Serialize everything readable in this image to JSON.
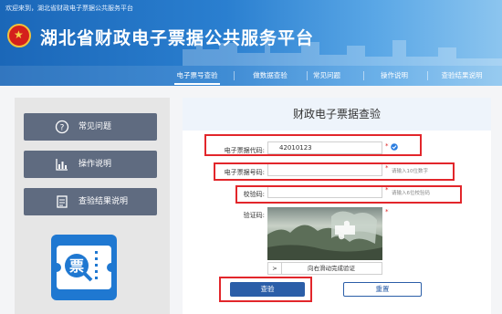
{
  "header": {
    "welcome": "欢迎来到，湖北省财政电子票据公共服务平台",
    "title": "湖北省财政电子票据公共服务平台",
    "nav": [
      "电子票号查验",
      "做数据查验",
      "常见问题",
      "操作说明",
      "查验结果说明"
    ]
  },
  "sidebar": {
    "items": [
      {
        "label": "常见问题",
        "icon": "question-icon"
      },
      {
        "label": "操作说明",
        "icon": "chart-icon"
      },
      {
        "label": "查验结果说明",
        "icon": "document-icon"
      }
    ],
    "logo_text": "票"
  },
  "main": {
    "title": "财政电子票据查验",
    "fields": {
      "code_label": "电子票据代码:",
      "code_value": "42010123",
      "number_label": "电子票据号码:",
      "number_placeholder": "请输入10位数字",
      "check_label": "校验码:",
      "check_placeholder": "请输入6位校验码",
      "captcha_label": "验证码:",
      "required_mark": "*"
    },
    "slider_text": "向右滑动完成验证",
    "slider_arrow": ">",
    "query_button": "查验",
    "reset_button": "重置"
  },
  "colors": {
    "header_blue": "#1b67b8",
    "sidebar_button": "#5f6b80",
    "query_button": "#2b5ea8",
    "highlight_red": "#e2262b"
  }
}
